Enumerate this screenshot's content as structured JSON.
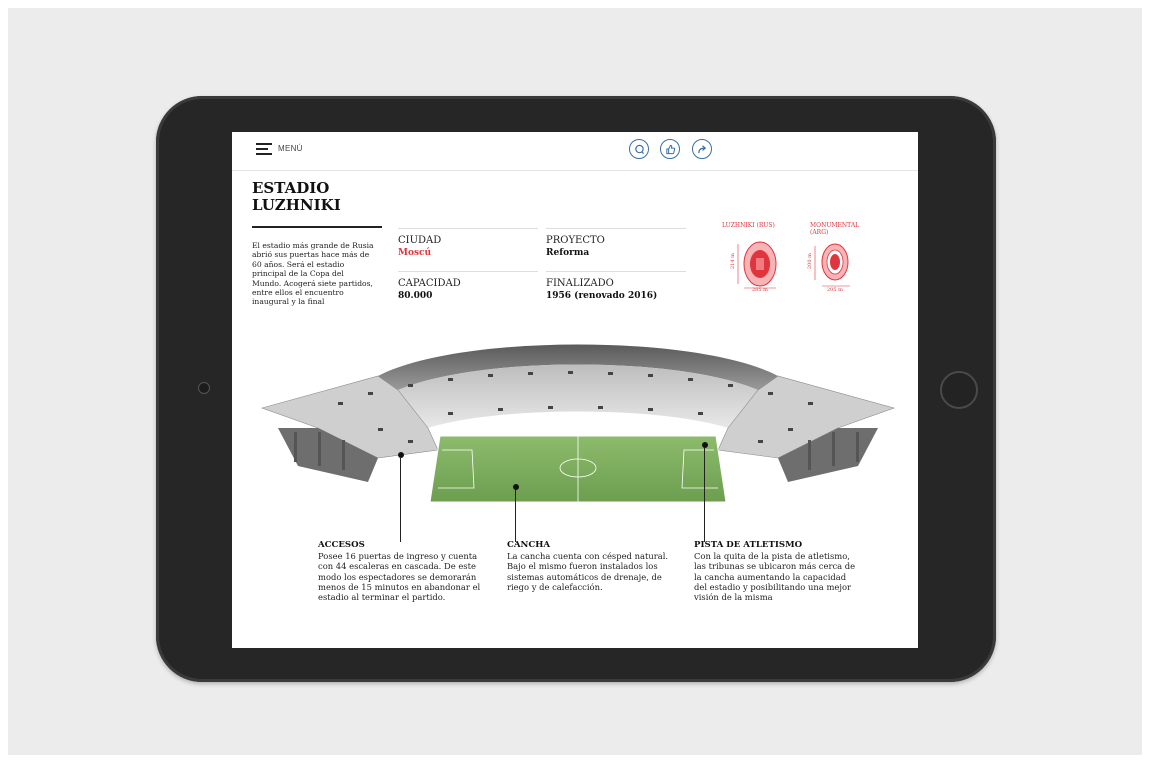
{
  "topbar": {
    "menu_label": "MENÚ",
    "actions": [
      "comment-icon",
      "like-icon",
      "share-icon"
    ]
  },
  "article": {
    "title_line1": "ESTADIO",
    "title_line2": "LUZHNIKI",
    "intro": "El estadio más grande de Rusia abrió sus puertas hace más de 60 años. Será el estadio principal de la Copa del Mundo. Acogerá siete partidos, entre ellos el encuentro inaugural y la final"
  },
  "facts": {
    "city_label": "CIUDAD",
    "city_value": "Moscú",
    "capacity_label": "CAPACIDAD",
    "capacity_value": "80.000",
    "project_label": "PROYECTO",
    "project_value": "Reforma",
    "finished_label": "FINALIZADO",
    "finished_value": "1956 (renovado 2016)"
  },
  "comparison": {
    "a_label": "LUZHNIKI (RUS)",
    "a_height": "214 m",
    "a_width": "285 m",
    "b_label_line1": "MONUMENTAL",
    "b_label_line2": "(ARG)",
    "b_height": "200 m",
    "b_width": "205 m"
  },
  "annotations": {
    "access_title": "ACCESOS",
    "access_text": "Posee 16 puertas de ingreso y cuenta con 44 escaleras en cascada. De este modo los espectadores se demorarán menos de 15 minutos en abandonar el estadio al terminar el partido.",
    "pitch_title": "CANCHA",
    "pitch_text": "La cancha cuenta con césped natural. Bajo el mismo fueron instalados los sistemas automáticos de drenaje, de riego y de calefacción.",
    "track_title": "PISTA DE ATLETISMO",
    "track_text": "Con la quita de la pista de atletismo, las tribunas se ubicaron más cerca de la cancha aumentando la capacidad del estadio y posibilitando una mejor visión de la misma"
  },
  "colors": {
    "accent_red": "#e0353d",
    "icon_blue": "#3b6fa5",
    "bezel": "#262626",
    "pitch_green": "#7fae5e"
  }
}
